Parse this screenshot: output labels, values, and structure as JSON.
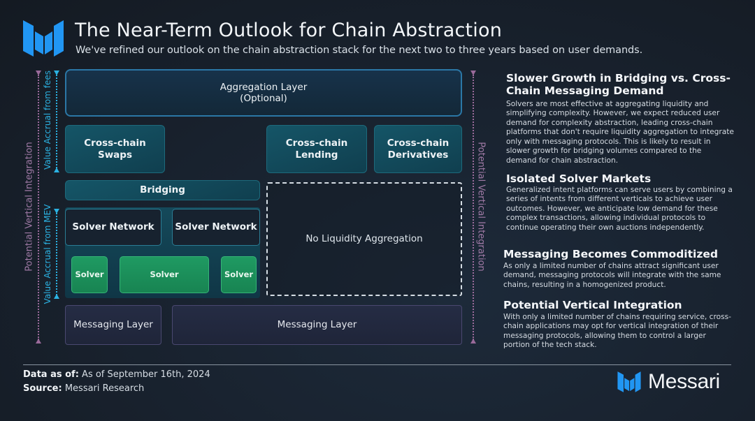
{
  "header": {
    "title": "The Near-Term Outlook for Chain Abstraction",
    "subtitle": "We've refined our outlook on the chain abstraction stack for the next two to three years based on user demands.",
    "logo_icon": "messari-logo-icon"
  },
  "colors": {
    "brand_blue": "#2196f3",
    "teal_box": "#155567",
    "solver_green": "#1f9a62",
    "messaging_purple": "#252c44",
    "axis_purple": "#9a6a9a",
    "axis_cyan": "#2bb3e3"
  },
  "diagram": {
    "aggregation_layer": {
      "line1": "Aggregation Layer",
      "line2": "(Optional)"
    },
    "applications": {
      "swaps": "Cross-chain Swaps",
      "lending": "Cross-chain Lending",
      "derivatives_line1": "Cross-chain",
      "derivatives_line2": "Derivatives"
    },
    "bridging": "Bridging",
    "solver_networks": [
      "Solver Network",
      "Solver Network"
    ],
    "solvers": [
      "Solver",
      "Solver",
      "Solver"
    ],
    "no_liquidity": "No Liquidity Aggregation",
    "messaging_layers": [
      "Messaging Layer",
      "Messaging Layer"
    ],
    "axes": {
      "left_outer": "Potential Vertical Integration",
      "left_fees": "Value Accrual from fees",
      "left_mev": "Value Accrual from MEV",
      "right": "Potential Vertical Integration"
    }
  },
  "notes": [
    {
      "heading_line1": "Slower Growth in Bridging vs. Cross-",
      "heading_line2": "Chain Messaging Demand",
      "body": "Solvers are most effective at aggregating liquidity and simplifying complexity. However, we expect reduced user demand for complexity abstraction, leading cross-chain platforms that don't require liquidity aggregation to integrate only with messaging protocols. This is likely to result in slower growth for bridging volumes compared to the demand for chain abstraction."
    },
    {
      "heading": "Isolated Solver Markets",
      "body": "Generalized intent platforms can serve users by combining a series of intents from different verticals to achieve user outcomes. However, we anticipate low demand for these complex transactions, allowing individual protocols to continue operating their own auctions independently."
    },
    {
      "heading": "Messaging Becomes Commoditized",
      "body": "As only a limited number of chains attract significant user demand, messaging protocols will integrate with the same chains, resulting in a homogenized product."
    },
    {
      "heading": "Potential Vertical Integration",
      "body": "With only a limited number of chains requiring service, cross-chain applications may opt for vertical integration of their messaging protocols, allowing them to control a larger portion of the tech stack."
    }
  ],
  "footer": {
    "data_label": "Data as of:",
    "data_value": "As of September 16th, 2024",
    "source_label": "Source:",
    "source_value": "Messari Research",
    "brand": "Messari"
  }
}
